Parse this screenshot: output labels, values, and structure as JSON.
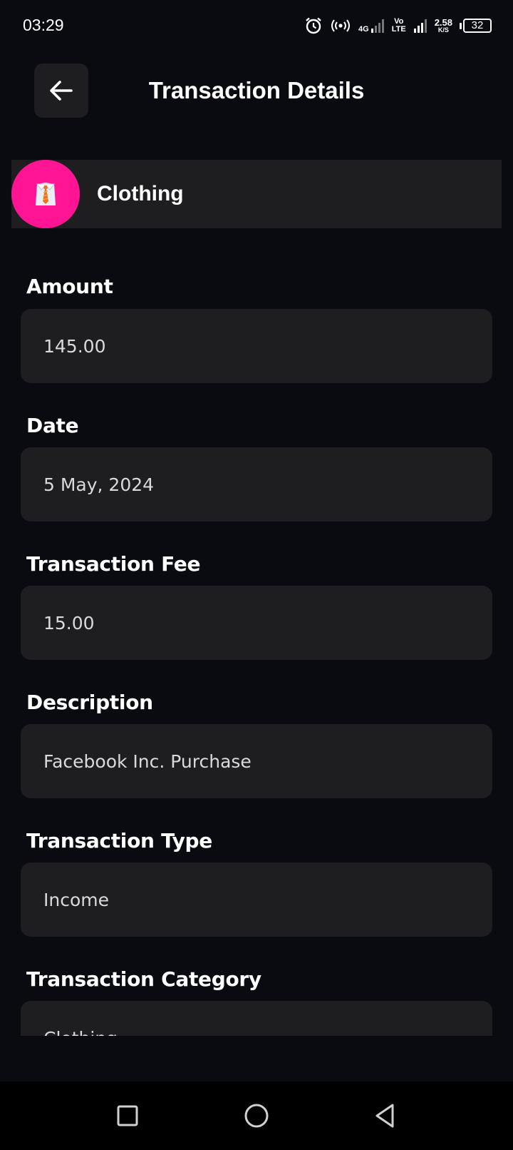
{
  "status_bar": {
    "time": "03:29",
    "net_type": "4G",
    "volte_top": "Vo",
    "volte_bottom": "LTE",
    "speed_value": "2.58",
    "speed_unit": "K/S",
    "battery": "32"
  },
  "header": {
    "title": "Transaction Details",
    "back_icon": "arrow-left-icon"
  },
  "category": {
    "name": "Clothing",
    "icon": "necktie-shirt-icon",
    "icon_color": "#ff1493"
  },
  "fields": [
    {
      "label": "Amount",
      "value": "145.00"
    },
    {
      "label": "Date",
      "value": "5 May, 2024"
    },
    {
      "label": "Transaction Fee",
      "value": "15.00"
    },
    {
      "label": "Description",
      "value": "Facebook Inc. Purchase"
    },
    {
      "label": "Transaction Type",
      "value": "Income"
    },
    {
      "label": "Transaction Category",
      "value": "Clothing"
    }
  ],
  "nav": {
    "recent_icon": "square-icon",
    "home_icon": "circle-icon",
    "back_icon": "triangle-back-icon"
  }
}
